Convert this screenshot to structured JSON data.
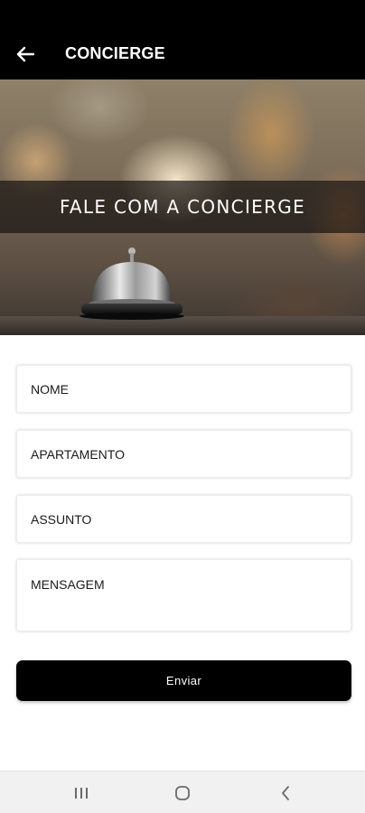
{
  "app_bar": {
    "title": "CONCIERGE",
    "back_icon": "arrow-left-icon",
    "background": "#000000"
  },
  "hero": {
    "banner_text": "FALE COM A CONCIERGE",
    "image_icon": "service-bell-icon"
  },
  "form": {
    "name_placeholder": "NOME",
    "apartment_placeholder": "APARTAMENTO",
    "subject_placeholder": "ASSUNTO",
    "message_placeholder": "MENSAGEM",
    "submit_label": "Enviar"
  },
  "system_nav": {
    "recents_icon": "recents-icon",
    "home_icon": "home-icon",
    "back_icon": "chevron-left-icon"
  },
  "colors": {
    "accent": "#000000",
    "background": "#ffffff",
    "nav_bar": "#f1f1f1"
  }
}
